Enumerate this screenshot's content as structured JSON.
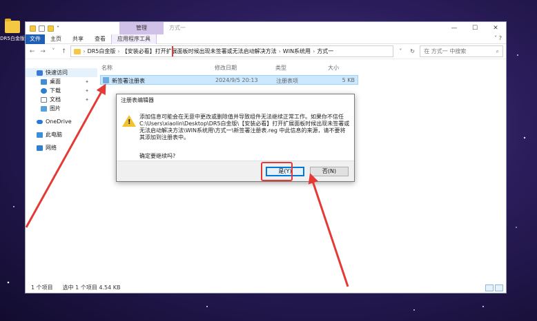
{
  "desktop": {
    "icon_label": "DR5白金版"
  },
  "window": {
    "context_tab": "管理",
    "title": "方式一",
    "controls": {
      "minimize": "—",
      "maximize": "☐",
      "close": "✕"
    }
  },
  "ribbon": {
    "file": "文件",
    "tabs": [
      "主页",
      "共享",
      "查看"
    ],
    "app_tab": "应用程序工具",
    "collapse": "˅ ?"
  },
  "nav": {
    "back": "←",
    "forward": "→",
    "dropdown": "˅",
    "up": "↑"
  },
  "address": {
    "crumbs": [
      "DR5白金版",
      "【安装必看】打开扩展面板时候出现未签署或无法启动解决方法",
      "WIN系统用",
      "方式一"
    ],
    "dropdown": "˅",
    "refresh": "↻"
  },
  "search": {
    "placeholder": "在 方式一 中搜索",
    "icon": "⌕"
  },
  "sidebar": {
    "items": [
      {
        "label": "快速访问"
      },
      {
        "label": "桌面"
      },
      {
        "label": "下载"
      },
      {
        "label": "文档"
      },
      {
        "label": "图片"
      },
      {
        "label": "OneDrive"
      },
      {
        "label": "此电脑"
      },
      {
        "label": "网络"
      }
    ],
    "pin": "📌"
  },
  "columns": {
    "name": "名称",
    "date": "修改日期",
    "type": "类型",
    "size": "大小"
  },
  "file": {
    "name": "新签署注册表",
    "date": "2024/9/5 20:13",
    "type": "注册表项",
    "size": "5 KB"
  },
  "status": {
    "count": "1 个项目",
    "selected": "选中 1 个项目  4.54 KB"
  },
  "dialog": {
    "title": "注册表编辑器",
    "message": "添加信息可能会在无意中更改或删除值并导致组件无法继续正常工作。如果你不信任 C:\\Users\\xiaolin\\Desktop\\DR5白金版\\【安装必看】打开扩展面板时候出现未签署或无法启动解决方法\\WIN系统用\\方式一\\新签署注册表.reg 中此信息的来源，请不要将其添加到注册表中。",
    "question": "确定要继续吗?",
    "yes": "是(Y)",
    "no": "否(N)",
    "warn_mark": "!"
  },
  "colors": {
    "highlight_red": "#e53935",
    "selection": "#cce8ff",
    "accent": "#0078d7"
  }
}
